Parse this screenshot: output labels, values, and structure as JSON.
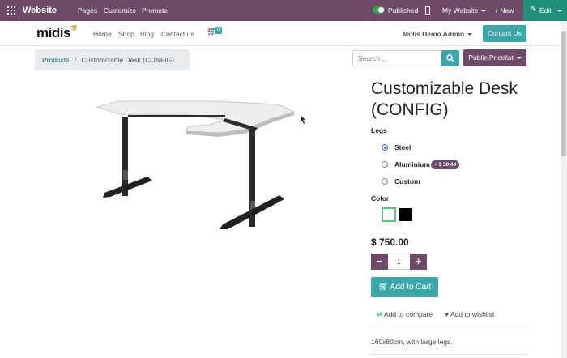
{
  "admin_bar": {
    "brand": "Website",
    "menu": [
      "Pages",
      "Customize",
      "Promote"
    ],
    "published_label": "Published",
    "site_label": "My Website",
    "new_label": "+ New",
    "edit_label": "Edit"
  },
  "nav": {
    "logo": "midis",
    "links": [
      "Home",
      "Shop",
      "Blog",
      "Contact us"
    ],
    "cart_count": "0",
    "user_label": "Midis Demo Admin",
    "contact_button": "Contact Us"
  },
  "breadcrumb": {
    "parent": "Products",
    "separator": "/",
    "current": "Customizable Desk (CONFIG)"
  },
  "search": {
    "placeholder": "Search..."
  },
  "pricelist": {
    "label": "Public Pricelist"
  },
  "product": {
    "title": "Customizable Desk (CONFIG)",
    "legs_label": "Legs",
    "legs_options": [
      {
        "label": "Steel",
        "selected": true
      },
      {
        "label": "Aluminium",
        "extra": "+ $ 50.40",
        "selected": false
      },
      {
        "label": "Custom",
        "selected": false
      }
    ],
    "color_label": "Color",
    "colors": [
      {
        "name": "white",
        "hex": "#ffffff",
        "selected": true
      },
      {
        "name": "black",
        "hex": "#000000",
        "selected": false
      }
    ],
    "price": "$ 750.00",
    "quantity": "1",
    "add_to_cart": "Add to Cart",
    "add_to_compare": "Add to compare",
    "add_to_wishlist": "Add to wishlist",
    "description": "160x80cm, with large legs."
  },
  "colors": {
    "admin_purple": "#6f4a68",
    "teal": "#3ca7a8",
    "edit_green": "#1f8f7a",
    "toggle_green": "#28a745"
  }
}
